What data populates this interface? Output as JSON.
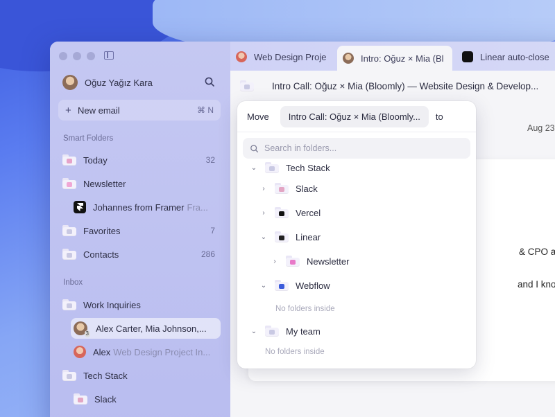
{
  "sidebar": {
    "user_name": "Oğuz Yağız Kara",
    "new_email": {
      "label": "New email",
      "shortcut": "⌘ N"
    },
    "smart_folders_label": "Smart Folders",
    "smart_folders": [
      {
        "label": "Today",
        "count": "32"
      },
      {
        "label": "Newsletter",
        "count": ""
      },
      {
        "label": "Johannes from Framer",
        "preview": "Fra..."
      },
      {
        "label": "Favorites",
        "count": "7"
      },
      {
        "label": "Contacts",
        "count": "286"
      }
    ],
    "inbox_label": "Inbox",
    "inbox": [
      {
        "label": "Work Inquiries"
      },
      {
        "label": "Alex Carter, Mia Johnson,..."
      },
      {
        "label": "Alex",
        "preview": "Web Design Project In..."
      },
      {
        "label": "Tech Stack"
      },
      {
        "label": "Slack"
      }
    ],
    "avatar_badge": "3"
  },
  "tabs": [
    {
      "label": "Web Design Proje"
    },
    {
      "label": "Intro: Oğuz × Mia (Bl"
    },
    {
      "label": "Linear auto-close"
    }
  ],
  "mail": {
    "title": "Intro Call: Oğuz × Mia (Bloomly) — Website Design & Develop...",
    "date": "Aug 23",
    "line1": "& CPO at Bloomly.",
    "line2": "and I know you'd d"
  },
  "move_popover": {
    "move_label": "Move",
    "subject": "Intro Call: Oğuz × Mia (Bloomly...",
    "to_label": "to",
    "search_placeholder": "Search in folders...",
    "tree": {
      "tech_stack": "Tech Stack",
      "slack": "Slack",
      "vercel": "Vercel",
      "linear": "Linear",
      "newsletter": "Newsletter",
      "webflow": "Webflow",
      "webflow_empty": "No folders inside",
      "my_team": "My team",
      "my_team_empty": "No folders inside"
    }
  },
  "colors": {
    "accent_purple": "#b9bdf0",
    "vercel": "#111111",
    "webflow": "#3b5bdb",
    "newsletter_pink": "#e879c8"
  }
}
